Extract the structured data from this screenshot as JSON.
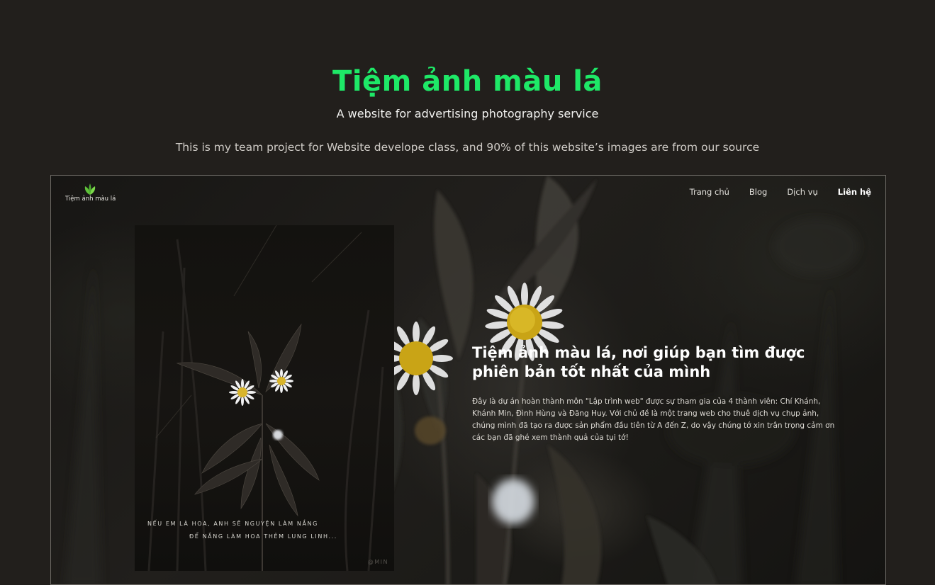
{
  "hero": {
    "title": "Tiệm ảnh màu lá",
    "subtitle": "A website for advertising photography service",
    "description": "This is my team project for Website develope class, and 90% of this website’s images are from our source"
  },
  "preview": {
    "logo": {
      "text": "Tiệm ảnh màu lá",
      "icon": "leaf-icon"
    },
    "nav": [
      {
        "label": "Trang chủ"
      },
      {
        "label": "Blog"
      },
      {
        "label": "Dịch vụ"
      },
      {
        "label": "Liên hệ",
        "active": true
      }
    ],
    "card": {
      "poem_line_1": "NẾU EM LÀ HOA, ANH SẼ NGUYỆN LÀM NẮNG",
      "poem_line_2": "ĐỂ NẮNG LÀM HOA THÊM LUNG LINH...",
      "watermark": "@MIN"
    },
    "headline": "Tiệm ảnh màu lá, nơi giúp bạn tìm được phiên bản tốt nhất của mình",
    "body": "Đây là dự án hoàn thành môn \"Lập trình web\" được sự tham gia của 4 thành viên: Chí Khánh, Khánh Min, Đình Hùng và Đăng Huy. Với chủ đề là một trang web cho thuê dịch vụ chụp ảnh, chúng mình đã tạo ra được sản phẩm đầu tiên từ A đến Z, do vậy chúng tớ xin trân trọng cảm ơn các bạn đã ghé xem thành quả của tụi tớ!"
  },
  "colors": {
    "background": "#221f1c",
    "accent_green": "#1ee867",
    "text_light": "#f1f1ef"
  }
}
